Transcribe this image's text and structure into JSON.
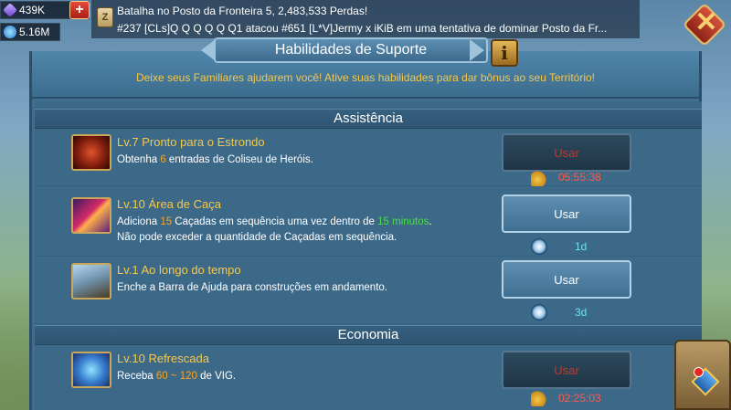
{
  "resources": {
    "gems": "439K",
    "power": "5.16M",
    "plus_label": "+"
  },
  "ticker": {
    "line1": "Batalha no Posto da Fronteira 5, 2,483,533 Perdas!",
    "line2": "#237 [CLs]Q Q Q Q Q Q1 atacou #651 [L*V]Jermy x iKiB em uma tentativa de dominar Posto da Fr..."
  },
  "panel": {
    "title": "Habilidades de Suporte",
    "info_label": "i",
    "subtitle": "Deixe seus Familiares ajudarem você!  Ative suas habilidades para dar bônus ao seu Território!"
  },
  "sections": {
    "assistencia": "Assistência",
    "economia": "Economia"
  },
  "skills": [
    {
      "title": "Lv.7 Pronto para o Estrondo",
      "desc_a": "Obtenha ",
      "desc_hl": "6",
      "desc_b": " entradas de Coliseu de Heróis.",
      "button": "Usar",
      "timer": "05:55:38"
    },
    {
      "title": "Lv.10 Área de Caça",
      "desc_a": "Adiciona ",
      "desc_hl": "15",
      "desc_b": " Caçadas em sequência uma vez dentro de ",
      "desc_hl2": "15 minutos",
      "desc_c": ".",
      "desc_line2": "Não pode exceder a quantidade de Caçadas em sequência.",
      "button": "Usar",
      "timer": "1d"
    },
    {
      "title": "Lv.1 Ao longo do tempo",
      "desc_a": "Enche a Barra de Ajuda para construções em andamento.",
      "button": "Usar",
      "timer": "3d"
    },
    {
      "title": "Lv.10 Refrescada",
      "desc_a": "Receba ",
      "desc_hl": "60 ~ 120",
      "desc_b": " de VIG.",
      "button": "Usar",
      "timer": "02:25:03"
    }
  ],
  "colors": {
    "accent_gold": "#f5c84b",
    "disabled_red": "#c0392b",
    "highlight_green": "#4cd94c",
    "timer_cyan": "#6fe0ef"
  }
}
